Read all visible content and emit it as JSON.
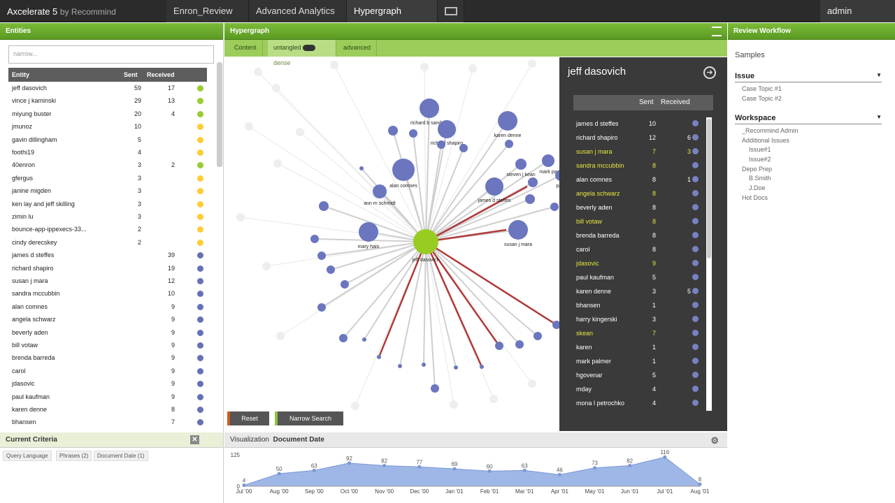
{
  "app": {
    "brand": "Axcelerate 5",
    "brand_by": "by Recommind",
    "user": "admin"
  },
  "tabs": [
    {
      "label": "Enron_Review"
    },
    {
      "label": "Advanced Analytics"
    },
    {
      "label": "Hypergraph"
    }
  ],
  "entities": {
    "title": "Entities",
    "search_placeholder": "narrow...",
    "headers": {
      "entity": "Entity",
      "sent": "Sent",
      "received": "Received"
    },
    "rows": [
      {
        "name": "jeff dasovich",
        "sent": "59",
        "received": "17",
        "color": "#99cc33"
      },
      {
        "name": "vince j kaminski",
        "sent": "29",
        "received": "13",
        "color": "#99cc33"
      },
      {
        "name": "miyung buster",
        "sent": "20",
        "received": "4",
        "color": "#99cc33"
      },
      {
        "name": "jmunoz",
        "sent": "10",
        "received": "",
        "color": "#ffcc33"
      },
      {
        "name": "gavin dillingham",
        "sent": "5",
        "received": "",
        "color": "#ffcc33"
      },
      {
        "name": "foothi19",
        "sent": "4",
        "received": "",
        "color": "#ffcc33"
      },
      {
        "name": "40enron",
        "sent": "3",
        "received": "2",
        "color": "#99cc33"
      },
      {
        "name": "gfergus",
        "sent": "3",
        "received": "",
        "color": "#ffcc33"
      },
      {
        "name": "janine migden",
        "sent": "3",
        "received": "",
        "color": "#ffcc33"
      },
      {
        "name": "ken lay and jeff skilling",
        "sent": "3",
        "received": "",
        "color": "#ffcc33"
      },
      {
        "name": "zimin lu",
        "sent": "3",
        "received": "",
        "color": "#ffcc33"
      },
      {
        "name": "bounce-app-ippexecs-33...",
        "sent": "2",
        "received": "",
        "color": "#ffcc33"
      },
      {
        "name": "cindy derecskey",
        "sent": "2",
        "received": "",
        "color": "#ffcc33"
      },
      {
        "name": "james d steffes",
        "sent": "",
        "received": "39",
        "color": "#6670b8"
      },
      {
        "name": "richard shapiro",
        "sent": "",
        "received": "19",
        "color": "#6670b8"
      },
      {
        "name": "susan j mara",
        "sent": "",
        "received": "12",
        "color": "#6670b8"
      },
      {
        "name": "sandra mccubbin",
        "sent": "",
        "received": "10",
        "color": "#6670b8"
      },
      {
        "name": "alan comnes",
        "sent": "",
        "received": "9",
        "color": "#6670b8"
      },
      {
        "name": "angela schwarz",
        "sent": "",
        "received": "9",
        "color": "#6670b8"
      },
      {
        "name": "beverly aden",
        "sent": "",
        "received": "9",
        "color": "#6670b8"
      },
      {
        "name": "bill votaw",
        "sent": "",
        "received": "9",
        "color": "#6670b8"
      },
      {
        "name": "brenda barreda",
        "sent": "",
        "received": "9",
        "color": "#6670b8"
      },
      {
        "name": "carol",
        "sent": "",
        "received": "9",
        "color": "#6670b8"
      },
      {
        "name": "jdasovic",
        "sent": "",
        "received": "9",
        "color": "#6670b8"
      },
      {
        "name": "paul kaufman",
        "sent": "",
        "received": "9",
        "color": "#6670b8"
      },
      {
        "name": "karen denne",
        "sent": "",
        "received": "8",
        "color": "#6670b8"
      },
      {
        "name": "bhansen",
        "sent": "",
        "received": "7",
        "color": "#6670b8"
      }
    ]
  },
  "hypergraph": {
    "title": "Hypergraph",
    "subtabs": {
      "content": "Content",
      "untangled": "untangled",
      "dense": "dense",
      "advanced": "advanced"
    },
    "buttons": {
      "reset": "Reset",
      "narrow": "Narrow Search"
    },
    "center_label": "jeff dasovich",
    "node_labels": [
      "richard b sanders",
      "richard shapiro",
      "karen denne",
      "steven j kean",
      "mark pa",
      "alan comnes",
      "ann m schmidt",
      "james d steffes",
      "mary hain",
      "susan j mara",
      "paul"
    ]
  },
  "detail": {
    "name": "jeff dasovich",
    "sent_label": "Sent",
    "received_label": "Received",
    "rows": [
      {
        "name": "james d steffes",
        "sent": "10",
        "received": "",
        "hl": false
      },
      {
        "name": "richard shapiro",
        "sent": "12",
        "received": "6",
        "hl": false
      },
      {
        "name": "susan j mara",
        "sent": "7",
        "received": "3",
        "hl": true
      },
      {
        "name": "sandra mccubbin",
        "sent": "8",
        "received": "",
        "hl": true
      },
      {
        "name": "alan comnes",
        "sent": "8",
        "received": "1",
        "hl": false
      },
      {
        "name": "angela schwarz",
        "sent": "8",
        "received": "",
        "hl": true
      },
      {
        "name": "beverly aden",
        "sent": "8",
        "received": "",
        "hl": false
      },
      {
        "name": "bill votaw",
        "sent": "8",
        "received": "",
        "hl": true
      },
      {
        "name": "brenda barreda",
        "sent": "8",
        "received": "",
        "hl": false
      },
      {
        "name": "carol",
        "sent": "8",
        "received": "",
        "hl": false
      },
      {
        "name": "jdasovic",
        "sent": "9",
        "received": "",
        "hl": true
      },
      {
        "name": "paul kaufman",
        "sent": "5",
        "received": "",
        "hl": false
      },
      {
        "name": "karen denne",
        "sent": "3",
        "received": "5",
        "hl": false
      },
      {
        "name": "bhansen",
        "sent": "1",
        "received": "",
        "hl": false
      },
      {
        "name": "harry kingerski",
        "sent": "3",
        "received": "",
        "hl": false
      },
      {
        "name": "skean",
        "sent": "7",
        "received": "",
        "hl": true
      },
      {
        "name": "karen",
        "sent": "1",
        "received": "",
        "hl": false
      },
      {
        "name": "mark palmer",
        "sent": "1",
        "received": "",
        "hl": false
      },
      {
        "name": "hgovenar",
        "sent": "5",
        "received": "",
        "hl": false
      },
      {
        "name": "mday",
        "sent": "4",
        "received": "",
        "hl": false
      },
      {
        "name": "mona l petrochko",
        "sent": "4",
        "received": "",
        "hl": false
      }
    ]
  },
  "review": {
    "title": "Review Workflow",
    "samples": "Samples",
    "issue": "Issue",
    "issue_items": [
      "Case Topic #1",
      "Case Topic #2"
    ],
    "workspace": "Workspace",
    "ws_items": [
      "_Recommind Admin",
      "Additional Issues",
      "Issue#1",
      "Issue#2",
      "Depo Prep",
      "B.Smith",
      "J.Doe",
      "Hot Docs"
    ]
  },
  "criteria": {
    "title": "Current Criteria",
    "pills": [
      "Query Language",
      "Phrases (2)",
      "Document Date (1)"
    ]
  },
  "viz": {
    "label": "Visualization",
    "sub": "Document Date"
  },
  "chart_data": {
    "type": "area",
    "x": [
      "Jul '00",
      "Aug '00",
      "Sep '00",
      "Oct '00",
      "Nov '00",
      "Dec '00",
      "Jan '01",
      "Feb '01",
      "Mar '01",
      "Apr '01",
      "May '01",
      "Jun '01",
      "Jul '01",
      "Aug '01"
    ],
    "values": [
      4,
      50,
      63,
      92,
      82,
      77,
      69,
      60,
      63,
      46,
      73,
      82,
      116,
      8
    ],
    "ymax_label": "125",
    "ymin_label": "0",
    "ylim": [
      0,
      125
    ],
    "color": "#9fb7e6"
  }
}
